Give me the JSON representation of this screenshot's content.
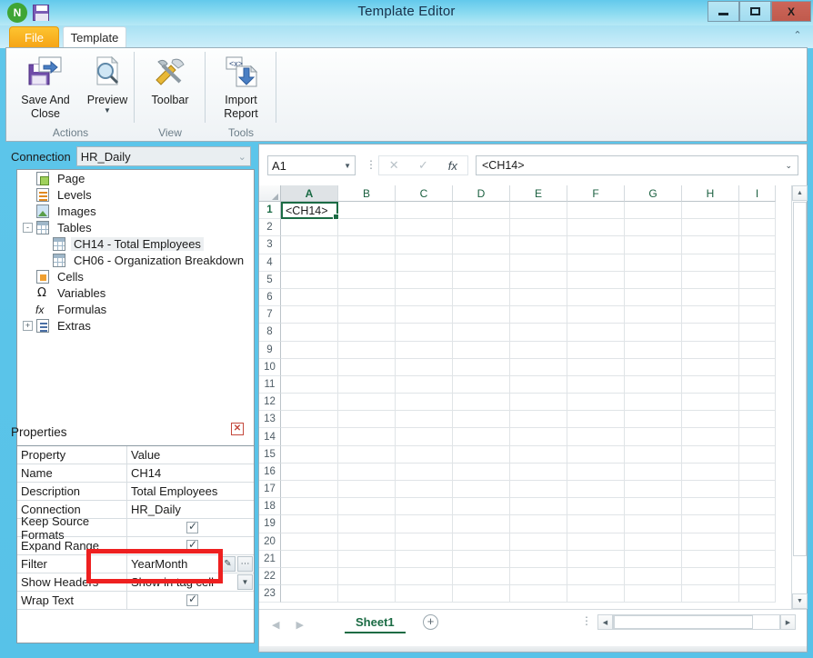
{
  "window": {
    "title": "Template Editor",
    "app_icon": "n-logo-icon",
    "save_icon": "save-floppy-icon",
    "controls": {
      "minimize": "–",
      "maximize": "□",
      "close": "X"
    },
    "collapse_ribbon_icon": "chevron-up-icon"
  },
  "tabs": [
    {
      "id": "file",
      "label": "File"
    },
    {
      "id": "template",
      "label": "Template"
    }
  ],
  "ribbon": {
    "groups": [
      {
        "name": "Actions",
        "label": "Actions",
        "items": [
          {
            "label": "Save And\nClose",
            "line1": "Save And",
            "line2": "Close",
            "icon": "save-export-icon",
            "caret": false
          },
          {
            "label": "Preview",
            "line1": "Preview",
            "line2": "",
            "icon": "preview-magnifier-icon",
            "caret": true
          }
        ]
      },
      {
        "name": "View",
        "label": "View",
        "items": [
          {
            "label": "Toolbar",
            "line1": "Toolbar",
            "line2": "",
            "icon": "hammer-wrench-icon",
            "caret": false
          }
        ]
      },
      {
        "name": "Tools",
        "label": "Tools",
        "items": [
          {
            "label": "Import Report",
            "line1": "Import",
            "line2": "Report",
            "icon": "import-report-icon",
            "caret": false
          }
        ]
      }
    ]
  },
  "left_pane": {
    "connection": {
      "label": "Connection",
      "value": "HR_Daily",
      "caret_icon": "chevron-down-icon"
    },
    "tree": [
      {
        "label": "Page",
        "icon": "page-icon",
        "depth": 1,
        "expander": "",
        "selected": false
      },
      {
        "label": "Levels",
        "icon": "levels-icon",
        "depth": 1,
        "expander": "",
        "selected": false
      },
      {
        "label": "Images",
        "icon": "images-icon",
        "depth": 1,
        "expander": "",
        "selected": false
      },
      {
        "label": "Tables",
        "icon": "table-icon",
        "depth": 1,
        "expander": "-",
        "selected": false
      },
      {
        "label": "CH14 - Total Employees",
        "icon": "table-icon",
        "depth": 2,
        "expander": "",
        "selected": true
      },
      {
        "label": "CH06 - Organization Breakdown",
        "icon": "table-icon",
        "depth": 2,
        "expander": "",
        "selected": false
      },
      {
        "label": "Cells",
        "icon": "cells-icon",
        "depth": 1,
        "expander": "",
        "selected": false
      },
      {
        "label": "Variables",
        "icon": "omega-icon",
        "depth": 1,
        "expander": "",
        "selected": false
      },
      {
        "label": "Formulas",
        "icon": "fx-icon",
        "depth": 1,
        "expander": "",
        "selected": false
      },
      {
        "label": "Extras",
        "icon": "extras-icon",
        "depth": 1,
        "expander": "+",
        "selected": false
      }
    ]
  },
  "properties": {
    "title": "Properties",
    "close_icon": "close-x-icon",
    "columns": {
      "property": "Property",
      "value": "Value"
    },
    "rows": [
      {
        "property": "Name",
        "value": "CH14",
        "type": "text"
      },
      {
        "property": "Description",
        "value": "Total Employees",
        "type": "text"
      },
      {
        "property": "Connection",
        "value": "HR_Daily",
        "type": "text"
      },
      {
        "property": "Keep Source Formats",
        "value": "",
        "type": "checkbox",
        "checked": true
      },
      {
        "property": "Expand Range",
        "value": "",
        "type": "checkbox",
        "checked": true
      },
      {
        "property": "Filter",
        "value": "YearMonth",
        "type": "editor",
        "editor_icons": [
          "pencil-icon",
          "ellipsis-icon"
        ]
      },
      {
        "property": "Show Headers",
        "value": "Show in tag cell",
        "type": "dropdown",
        "editor_icons": [
          "chevron-down-icon"
        ]
      },
      {
        "property": "Wrap Text",
        "value": "",
        "type": "checkbox",
        "checked": true
      }
    ],
    "highlight": {
      "target_row": "Filter",
      "color": "#ee2020"
    }
  },
  "spreadsheet": {
    "name_box": {
      "value": "A1",
      "caret_icon": "chevron-down-icon"
    },
    "formula_buttons": {
      "cancel": "✕",
      "accept": "✓",
      "fx": "fx"
    },
    "formula_bar": {
      "value": "<CH14>",
      "caret_icon": "chevron-down-icon"
    },
    "columns": [
      "A",
      "B",
      "C",
      "D",
      "E",
      "F",
      "G",
      "H",
      "I"
    ],
    "active_column": "A",
    "rows": [
      1,
      2,
      3,
      4,
      5,
      6,
      7,
      8,
      9,
      10,
      11,
      12,
      13,
      14,
      15,
      16,
      17,
      18,
      19,
      20,
      21,
      22,
      23
    ],
    "active_row": 1,
    "cells": {
      "A1": "<CH14>"
    },
    "sheet_tabs": [
      {
        "label": "Sheet1",
        "active": true
      }
    ],
    "add_sheet_icon": "plus-circle-icon",
    "nav_prev_icon": "triangle-left-icon",
    "nav_next_icon": "triangle-right-icon",
    "scroll_up_icon": "triangle-up-icon",
    "scroll_down_icon": "triangle-down-icon",
    "scroll_left_icon": "triangle-left-icon",
    "scroll_right_icon": "triangle-right-icon"
  }
}
